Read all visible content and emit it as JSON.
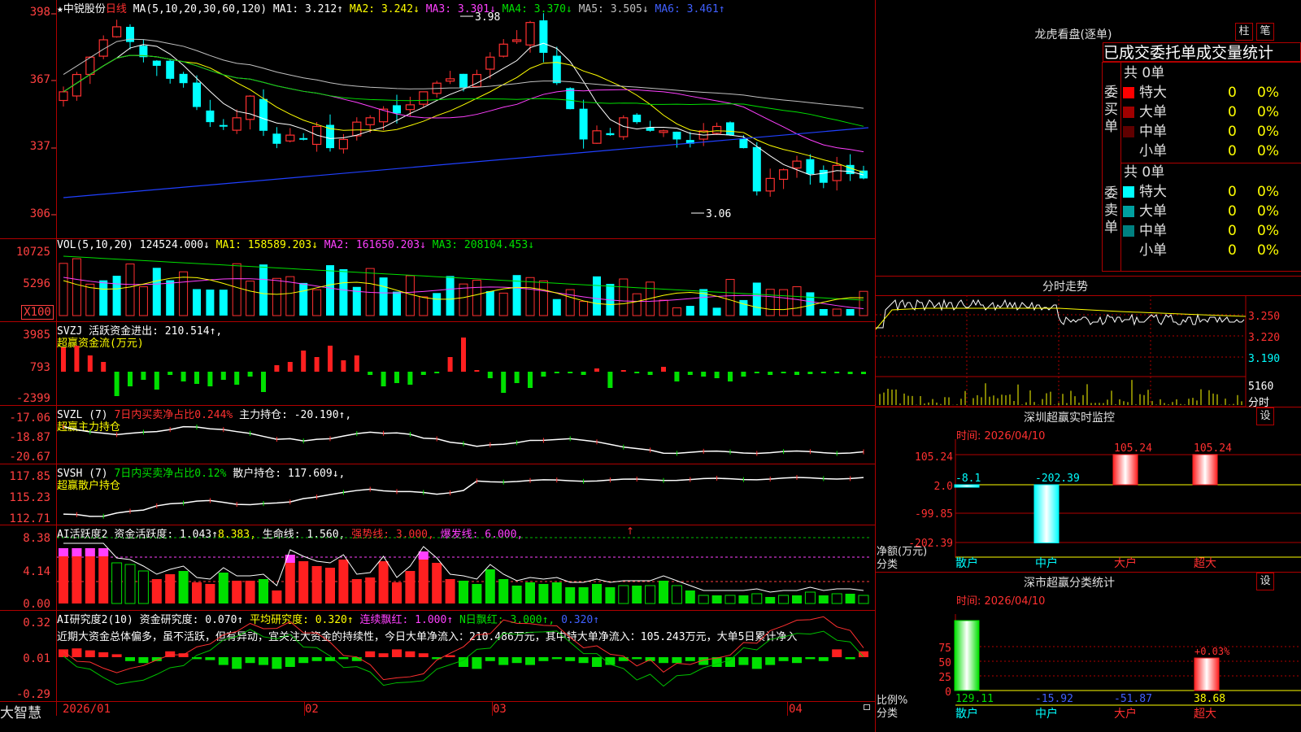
{
  "header": {
    "star": "★",
    "stock_name": "中锐股份",
    "period": "日线",
    "ma_label": "MA(5,10,20,30,60,120)",
    "ma1": "MA1: 3.212↑",
    "ma2": "MA2: 3.242↓",
    "ma3": "MA3: 3.301↓",
    "ma4": "MA4: 3.370↓",
    "ma5": "MA5: 3.505↓",
    "ma6": "MA6: 3.461↑"
  },
  "price_axis": [
    "398",
    "367",
    "337",
    "306"
  ],
  "price_annotations": {
    "high": "3.98",
    "low": "3.06"
  },
  "vol": {
    "header_label": "VOL(5,10,20)",
    "value": "124524.000↓",
    "ma1": "MA1: 158589.203↓",
    "ma2": "MA2: 161650.203↓",
    "ma3": "MA3: 208104.453↓",
    "axis": [
      "10725",
      "5296",
      "X100"
    ]
  },
  "svzj": {
    "name": "SVZJ",
    "label": "活跃资金进出: 210.514↑,",
    "sub": "超赢资金流(万元)",
    "axis": [
      "3985",
      "793",
      "-2399"
    ]
  },
  "svzl": {
    "name": "SVZL (7)",
    "label1": "7日内买卖净占比0.244%",
    "label2": "主力持仓: -20.190↑,",
    "sub": "超赢主力持仓",
    "axis": [
      "-17.06",
      "-18.87",
      "-20.67"
    ]
  },
  "svsh": {
    "name": "SVSH (7)",
    "label1": "7日内买卖净占比0.12%",
    "label2": "散户持仓: 117.609↓,",
    "sub": "超赢散户持仓",
    "axis": [
      "117.85",
      "115.23",
      "112.71"
    ]
  },
  "ai1": {
    "name": "AI活跃度2",
    "label1": "资金活跃度: 1.043↑",
    "label2": "8.383,",
    "label3": "生命线: 1.560,",
    "label4": "强势线: 3.000,",
    "label5": "爆发线: 6.000,",
    "axis": [
      "8.38",
      "4.14",
      "0.00"
    ]
  },
  "ai2": {
    "name": "AI研究度2(10)",
    "label1": "资金研究度: 0.070↑",
    "label2": "平均研究度: 0.320↑",
    "label3": "连续飘红: 1.000↑",
    "label4": "N日飘红: 3.000↑,",
    "label5": "0.320↑",
    "desc": "近期大资金总体偏多，虽不活跃，但有异动，宜关注大资金的持续性，今日大单净流入：210.486万元，其中特大单净流入：105.243万元，大单5日累计净入",
    "axis": [
      "0.32",
      "0.01",
      "-0.29"
    ]
  },
  "date_axis": [
    "2026/01",
    "02",
    "03",
    "04"
  ],
  "brand": "大智慧",
  "right": {
    "lhb_title": "龙虎看盘(逐单)",
    "btn_zhu": "柱",
    "btn_bi": "笔",
    "stats_title": "已成交委托单成交量统计",
    "buy_side": "委买单",
    "sell_side": "委卖单",
    "buy_total": "共 0单",
    "sell_total": "共 0单",
    "buy_rows": [
      {
        "label": "特大",
        "val": "0",
        "pct": "0%",
        "color": "#ff0000"
      },
      {
        "label": "大单",
        "val": "0",
        "pct": "0%",
        "color": "#a00000"
      },
      {
        "label": "中单",
        "val": "0",
        "pct": "0%",
        "color": "#600000"
      },
      {
        "label": "小单",
        "val": "0",
        "pct": "0%",
        "color": "#000000"
      }
    ],
    "sell_rows": [
      {
        "label": "特大",
        "val": "0",
        "pct": "0%",
        "color": "#00ffff"
      },
      {
        "label": "大单",
        "val": "0",
        "pct": "0%",
        "color": "#00a0a0"
      },
      {
        "label": "中单",
        "val": "0",
        "pct": "0%",
        "color": "#008080"
      },
      {
        "label": "小单",
        "val": "0",
        "pct": "0%",
        "color": "#000000"
      }
    ],
    "fenshi_title": "分时走势",
    "fenshi_axis": [
      "3.250",
      "3.220",
      "3.190"
    ],
    "fenshi_vol": "5160",
    "fenshi_vol_unit": "分时",
    "sz_title": "深圳超赢实时监控",
    "sz_btn": "设",
    "sz_time": "时间: 2026/04/10",
    "sz_axis": [
      "105.24",
      "2.0",
      "-99.85",
      "-202.39"
    ],
    "sz_ylabel": "净额(万元)",
    "sz_xlabel": "分类",
    "sz_values": [
      "-8.1",
      "-202.39",
      "105.24",
      "105.24"
    ],
    "sz_cats": [
      "散户",
      "中户",
      "大户",
      "超大"
    ],
    "fl_title": "深市超赢分类统计",
    "fl_btn": "设",
    "fl_time": "时间: 2026/04/10",
    "fl_axis": [
      "75",
      "50",
      "25",
      "0"
    ],
    "fl_ylabel": "比例%",
    "fl_xlabel": "分类",
    "fl_values": [
      "129.11",
      "-15.92",
      "-51.87",
      "38.68"
    ],
    "fl_annot": "+0.03%",
    "fl_cats": [
      "散户",
      "中户",
      "大户",
      "超大"
    ]
  }
}
